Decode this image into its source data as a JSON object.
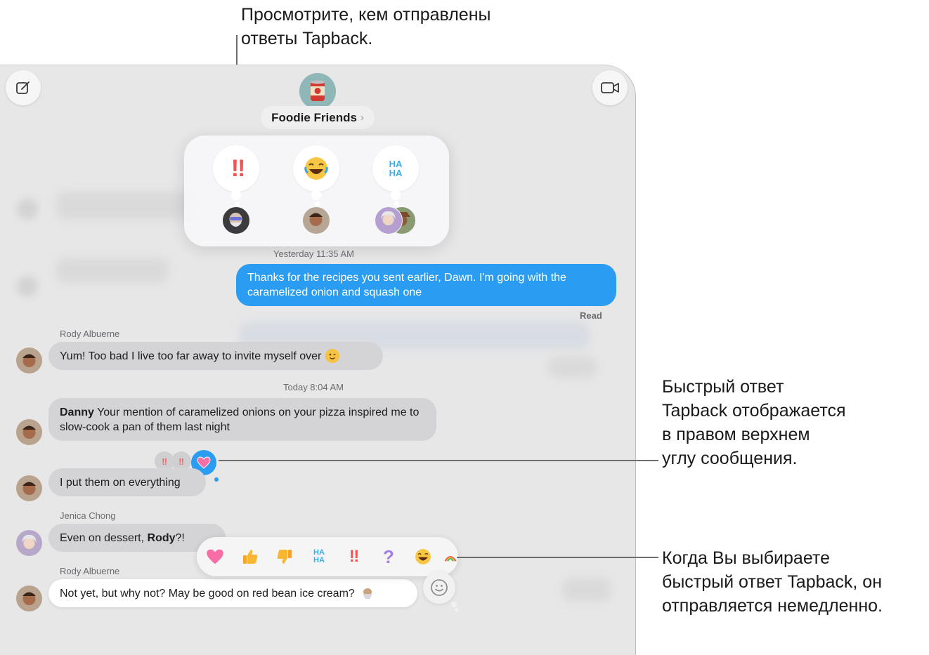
{
  "callouts": {
    "top": [
      "Просмотрите, кем отправлены",
      "ответы Tapback."
    ],
    "middle": [
      "Быстрый ответ",
      "Tapback отображается",
      "в правом верхнем",
      "углу сообщения."
    ],
    "bottom": [
      "Когда Вы выбираете",
      "быстрый ответ Tapback, он",
      "отправляется немедленно."
    ]
  },
  "conversation": {
    "title": "Foodie Friends",
    "chevron": "›"
  },
  "tapback_summary": [
    {
      "reaction": "exclamation",
      "label": "‼",
      "senders": 1
    },
    {
      "reaction": "laugh",
      "senders": 1
    },
    {
      "reaction": "haha",
      "label": "HA HA",
      "senders": 2
    }
  ],
  "messages": {
    "stamp1": "Yesterday 11:35 AM",
    "sent1": "Thanks for the recipes you sent earlier, Dawn. I'm going with the caramelized onion and squash one",
    "read_status": "Read",
    "sender_rody": "Rody Albuerne",
    "rody1": "Yum! Too bad I live too far away to invite myself over",
    "stamp2": "Today 8:04 AM",
    "rody2_mention": "Danny",
    "rody2_text": " Your mention of caramelized onions on your pizza inspired me to slow-cook a pan of them last night",
    "rody3": "I put them on everything",
    "sender_jenica": "Jenica Chong",
    "jenica1": "Even on dessert, ",
    "jenica1_mention": "Rody",
    "jenica1_end": "?!",
    "sender_rody2": "Rody Albuerne",
    "rody4": "Not yet, but why not? May be good on red bean ice cream?"
  },
  "reactions_on_message": [
    "‼",
    "‼",
    "heart"
  ],
  "picker_icons": [
    "heart-icon",
    "thumbs-up-icon",
    "thumbs-down-icon",
    "haha-icon",
    "exclamation-icon",
    "question-icon",
    "laugh-icon",
    "rainbow-icon"
  ],
  "colors": {
    "blue_bubble": "#2a9cf1",
    "gray_bubble": "#d4d4d6",
    "heart": "#f76da6"
  }
}
